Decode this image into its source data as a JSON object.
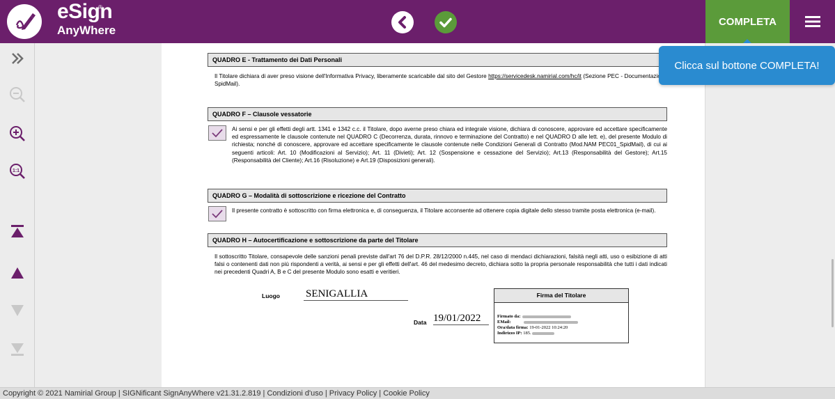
{
  "header": {
    "logo_name": "eSign",
    "logo_reg": "®",
    "logo_sub": "AnyWhere",
    "complete_label": "COMPLETA"
  },
  "tooltip": {
    "text": "Clicca sul bottone COMPLETA!"
  },
  "footer": {
    "text": "Copyright © 2021 Namirial Group | SIGNificant SignAnyWhere v21.31.2.819 | Condizioni d'uso | Privacy Policy | Cookie Policy"
  },
  "toolbar": {
    "icons": [
      "expand-panel-icon",
      "zoom-out-icon",
      "zoom-in-icon",
      "zoom-reset-icon",
      "first-page-icon",
      "previous-page-icon",
      "next-page-icon",
      "last-page-icon"
    ]
  },
  "document": {
    "sections": [
      {
        "title": "QUADRO E - Trattamento dei Dati Personali",
        "text": "Il Titolare dichiara di aver preso visione dell'Informativa Privacy, liberamente scaricabile dal sito del Gestore",
        "link": "https://servicedesk.namirial.com/hc/it",
        "text_after": "(Sezione PEC - Documentazione SpidMail)."
      },
      {
        "title": "QUADRO F – Clausole vessatorie",
        "text": "Ai sensi e per gli effetti degli artt. 1341 e 1342 c.c. il Titolare, dopo averne preso chiara ed integrale visione, dichiara di conoscere, approvare ed accettare specificamente ed espressamente le clausole contenute nel QUADRO C (Decorrenza, durata, rinnovo e terminazione del Contratto) e nel QUADRO D alle lett. e), del presente Modulo di richiesta; nonché di conoscere, approvare ed accettare specificamente le clausole contenute nelle Condizioni Generali di Contratto (Mod.NAM PEC01_SpidMail), di cui ai seguenti articoli: Art. 10 (Modificazioni al Servizio); Art. 11 (Divieti); Art. 12 (Sospensione e cessazione del Servizio); Art.13 (Responsabilità del Gestore); Art.15 (Responsabilità del Cliente); Art.16 (Risoluzione) e Art.19 (Disposizioni generali).",
        "checked": true
      },
      {
        "title": "QUADRO G – Modalità di sottoscrizione e ricezione del Contratto",
        "text": "Il presente contratto è sottoscritto con firma elettronica e, di conseguenza, il Titolare acconsente ad ottenere copia digitale dello stesso tramite posta elettronica (e-mail).",
        "checked": true
      },
      {
        "title": "QUADRO H – Autocertificazione e sottoscrizione da parte del Titolare",
        "text": "Il sottoscritto Titolare, consapevole delle sanzioni penali previste dall'art 76 del D.P.R. 28/12/2000 n.445, nel caso di mendaci dichiarazioni, falsità negli atti, uso o esibizione di atti falsi o contenenti dati non più rispondenti a verità, ai sensi e per gli effetti dell'art. 46 del medesimo decreto, dichiara sotto la propria personale responsabilità che tutti i dati indicati nei precedenti Quadri A, B e C del presente Modulo sono esatti e veritieri."
      }
    ],
    "luogo_label": "Luogo",
    "luogo_value": "SENIGALLIA",
    "data_label": "Data",
    "data_value": "19/01/2022",
    "signature": {
      "title": "Firma del Titolare",
      "signed_by_label": "Firmato da:",
      "email_label": "EMail:",
      "datetime_label": "Ora/data firma:",
      "datetime_value": "19-01-2022 10:24:20",
      "ip_label": "Indirizzo IP:",
      "ip_value": "185."
    }
  },
  "colors": {
    "header_bg": "#6b1f6b",
    "accent_green": "#5b9b3a",
    "tooltip_blue": "#2a8bd0",
    "checkbox_purple": "#7b3a7b"
  }
}
